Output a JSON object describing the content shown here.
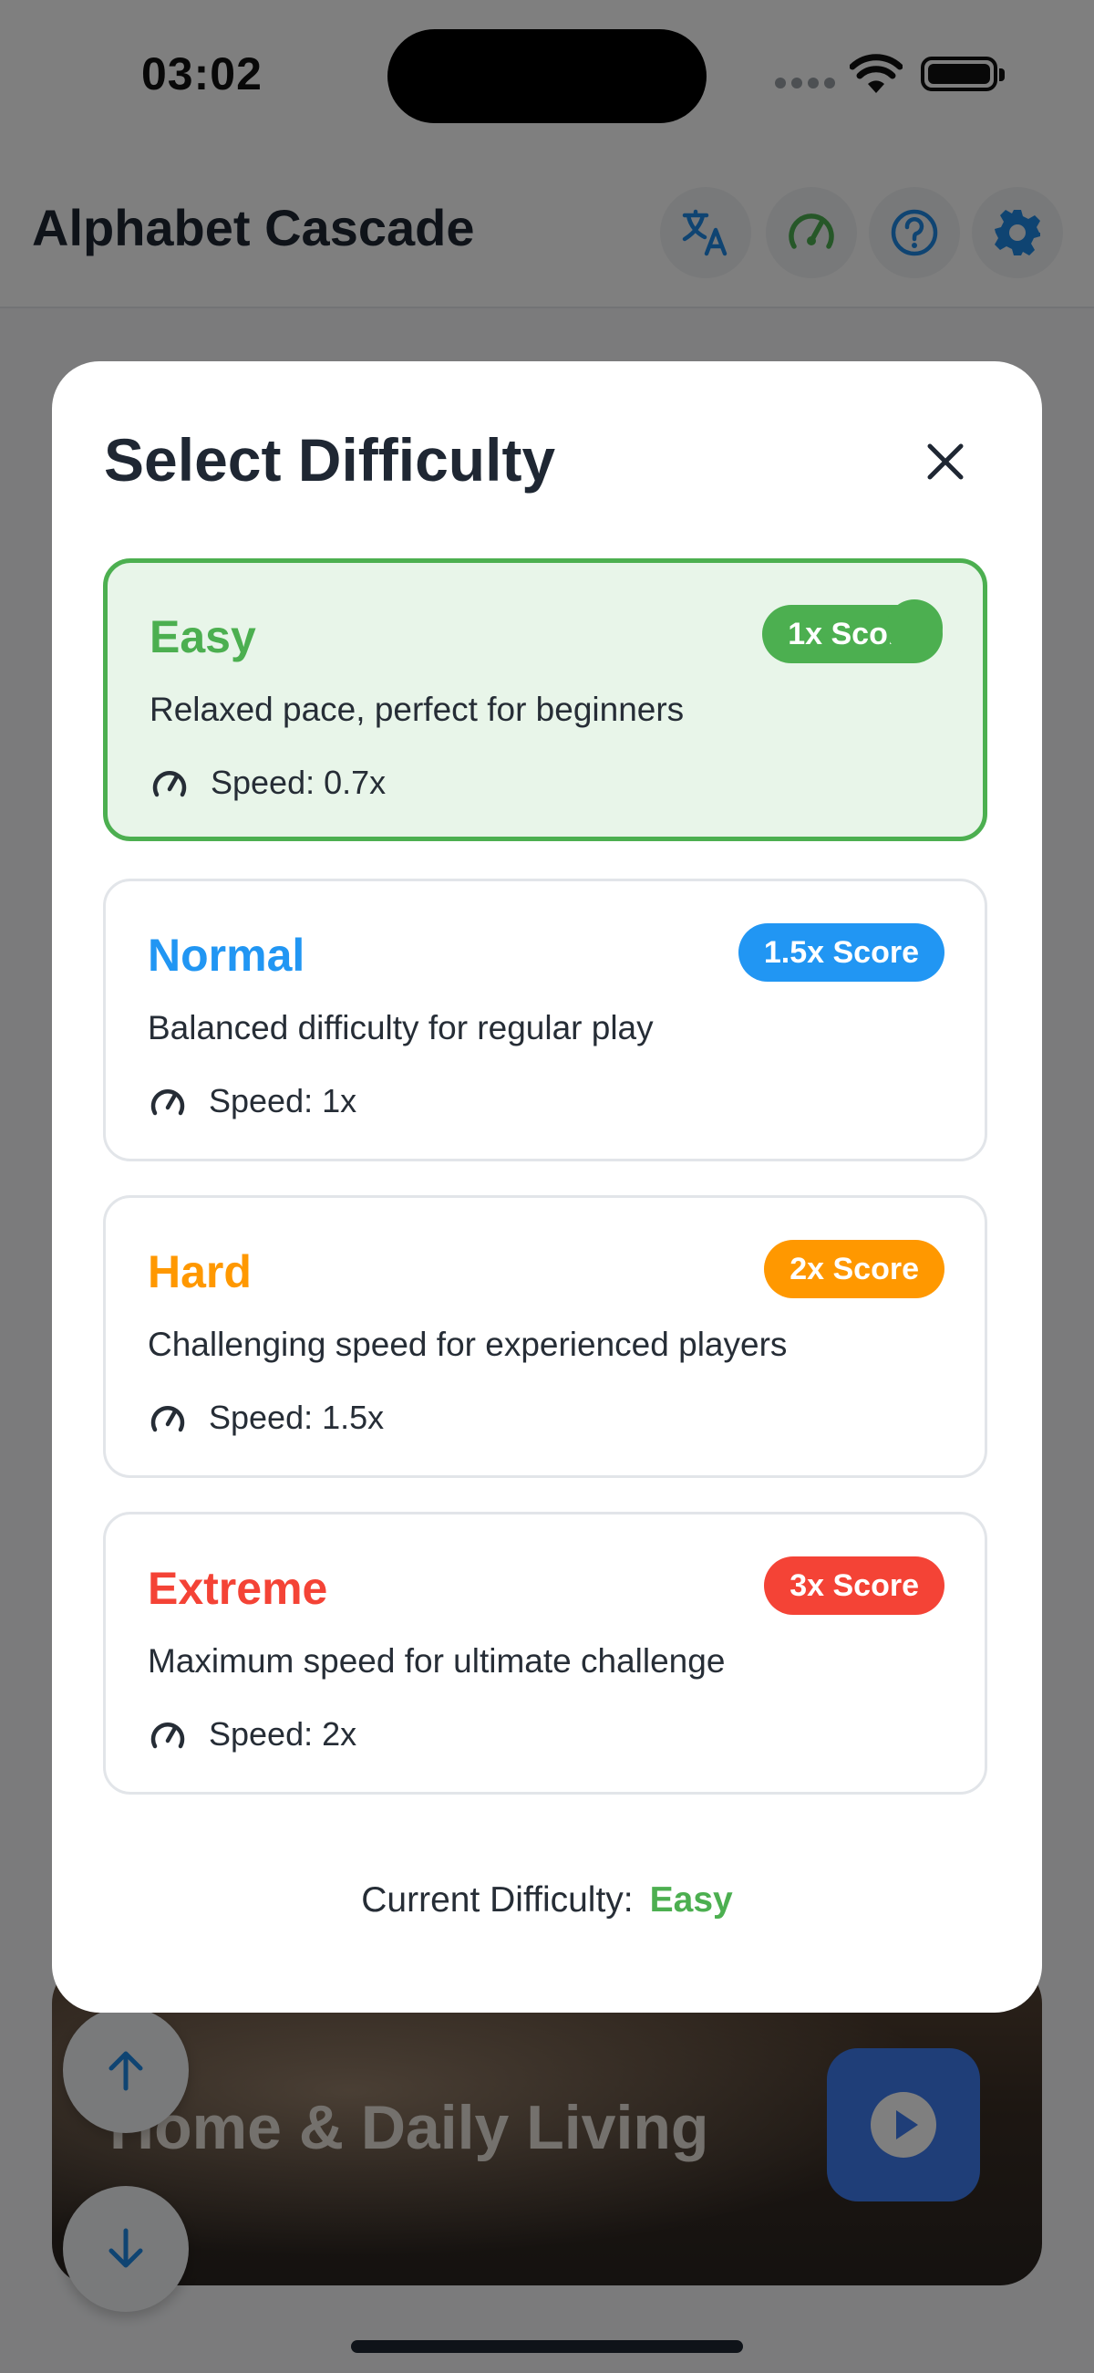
{
  "status_bar": {
    "time": "03:02"
  },
  "header": {
    "title": "Alphabet Cascade",
    "icons": [
      "translate-icon",
      "speedometer-icon",
      "help-icon",
      "settings-icon"
    ],
    "accent": "#1e88e5",
    "speed_icon_color": "#4caf50"
  },
  "background": {
    "game_title": "Home & Daily Living"
  },
  "modal": {
    "title": "Select Difficulty",
    "options": [
      {
        "name": "Easy",
        "badge": "1x Score",
        "description": "Relaxed pace, perfect for beginners",
        "speed": "Speed: 0.7x",
        "color": "#4caf50",
        "selected": true
      },
      {
        "name": "Normal",
        "badge": "1.5x Score",
        "description": "Balanced difficulty for regular play",
        "speed": "Speed: 1x",
        "color": "#2196f3",
        "selected": false
      },
      {
        "name": "Hard",
        "badge": "2x Score",
        "description": "Challenging speed for experienced players",
        "speed": "Speed: 1.5x",
        "color": "#ff9800",
        "selected": false
      },
      {
        "name": "Extreme",
        "badge": "3x Score",
        "description": "Maximum speed for ultimate challenge",
        "speed": "Speed: 2x",
        "color": "#f44336",
        "selected": false
      }
    ],
    "current_label": "Current Difficulty:",
    "current_value": "Easy"
  }
}
